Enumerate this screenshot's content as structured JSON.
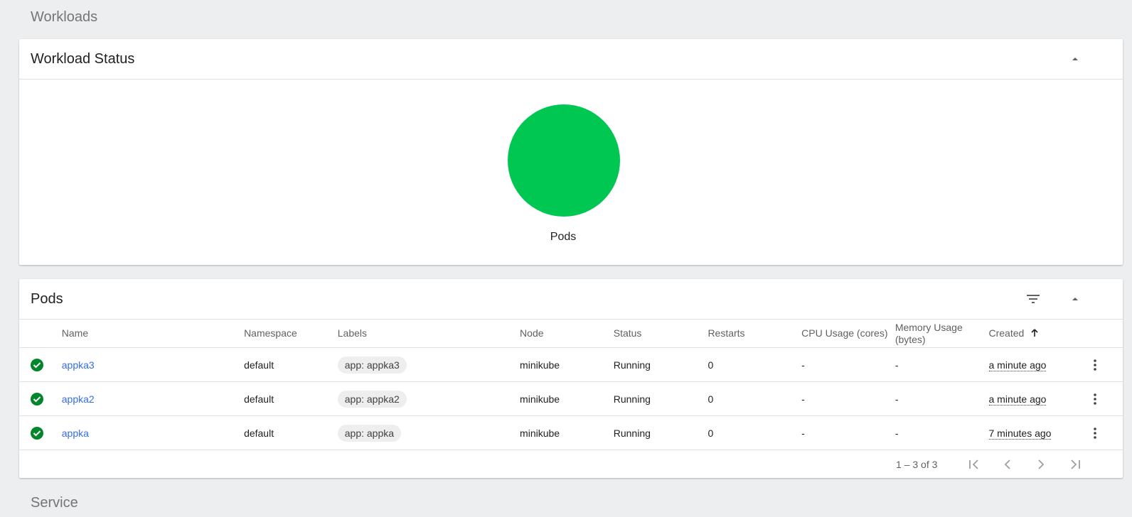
{
  "workloads": {
    "title": "Workloads"
  },
  "workload_status": {
    "title": "Workload Status",
    "pie_label": "Pods",
    "pie_color": "#00c752"
  },
  "pods": {
    "title": "Pods",
    "columns": {
      "name": "Name",
      "namespace": "Namespace",
      "labels": "Labels",
      "node": "Node",
      "status": "Status",
      "restarts": "Restarts",
      "cpu": "CPU Usage (cores)",
      "memory": "Memory Usage (bytes)",
      "created": "Created"
    },
    "rows": [
      {
        "name": "appka3",
        "namespace": "default",
        "label": "app: appka3",
        "node": "minikube",
        "status": "Running",
        "restarts": "0",
        "cpu": "-",
        "memory": "-",
        "created": "a minute ago"
      },
      {
        "name": "appka2",
        "namespace": "default",
        "label": "app: appka2",
        "node": "minikube",
        "status": "Running",
        "restarts": "0",
        "cpu": "-",
        "memory": "-",
        "created": "a minute ago"
      },
      {
        "name": "appka",
        "namespace": "default",
        "label": "app: appka",
        "node": "minikube",
        "status": "Running",
        "restarts": "0",
        "cpu": "-",
        "memory": "-",
        "created": "7 minutes ago"
      }
    ],
    "paginator": {
      "range": "1 – 3 of 3"
    }
  },
  "service": {
    "title": "Service"
  },
  "icons": {
    "collapse": "chevron-up-icon",
    "filter": "filter-icon",
    "status_ok": "check-circle-icon",
    "more": "more-vert-icon",
    "sort": "arrow-up-icon",
    "first": "first-page-icon",
    "prev": "chevron-left-icon",
    "next": "chevron-right-icon",
    "last": "last-page-icon"
  },
  "colors": {
    "accent_link": "#326de6",
    "status_ok": "#00872c",
    "background": "#edeef0"
  }
}
